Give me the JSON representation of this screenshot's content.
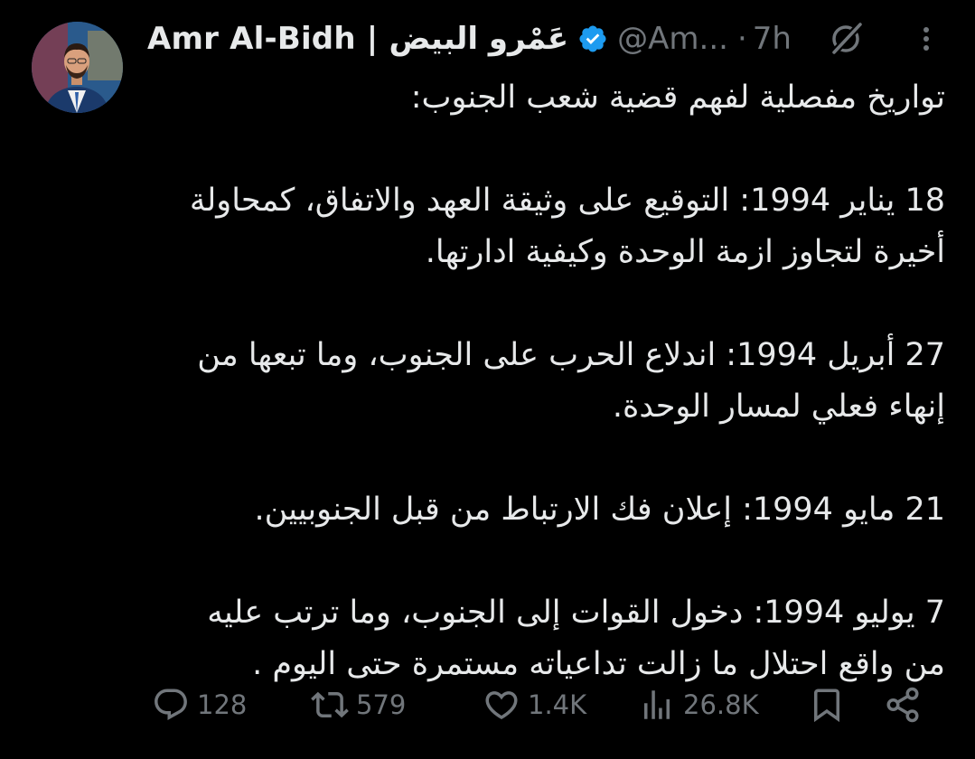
{
  "tweet": {
    "author_name": "Amr Al-Bidh | عَمْرو البيض",
    "handle": "@Am...",
    "separator": "·",
    "time": "7h",
    "paragraphs": [
      [
        "تواريخ مفصلية لفهم قضية شعب الجنوب:"
      ],
      [
        "18 يناير 1994: التوقيع على وثيقة العهد والاتفاق، كمحاولة",
        "أخيرة لتجاوز ازمة الوحدة وكيفية ادارتها."
      ],
      [
        "27 أبريل 1994: اندلاع الحرب على الجنوب، وما تبعها من",
        "إنهاء فعلي لمسار الوحدة."
      ],
      [
        "21 مايو 1994: إعلان فك الارتباط من قبل الجنوبيين."
      ],
      [
        "7 يوليو 1994: دخول القوات إلى الجنوب، وما ترتب عليه",
        "من واقع احتلال ما زالت تداعياته مستمرة حتى اليوم ."
      ]
    ]
  },
  "actions": {
    "replies": "128",
    "reposts": "579",
    "likes": "1.4K",
    "views": "26.8K"
  },
  "icons": {
    "verified": "verified-badge-icon",
    "grok": "grok-icon",
    "more": "more-vertical-icon",
    "reply": "reply-icon",
    "repost": "repost-icon",
    "like": "heart-icon",
    "views": "views-bar-chart-icon",
    "bookmark": "bookmark-icon",
    "share": "share-icon"
  },
  "colors": {
    "background": "#000000",
    "text": "#e7e9ea",
    "muted": "#71767b",
    "verified": "#1d9bf0"
  }
}
